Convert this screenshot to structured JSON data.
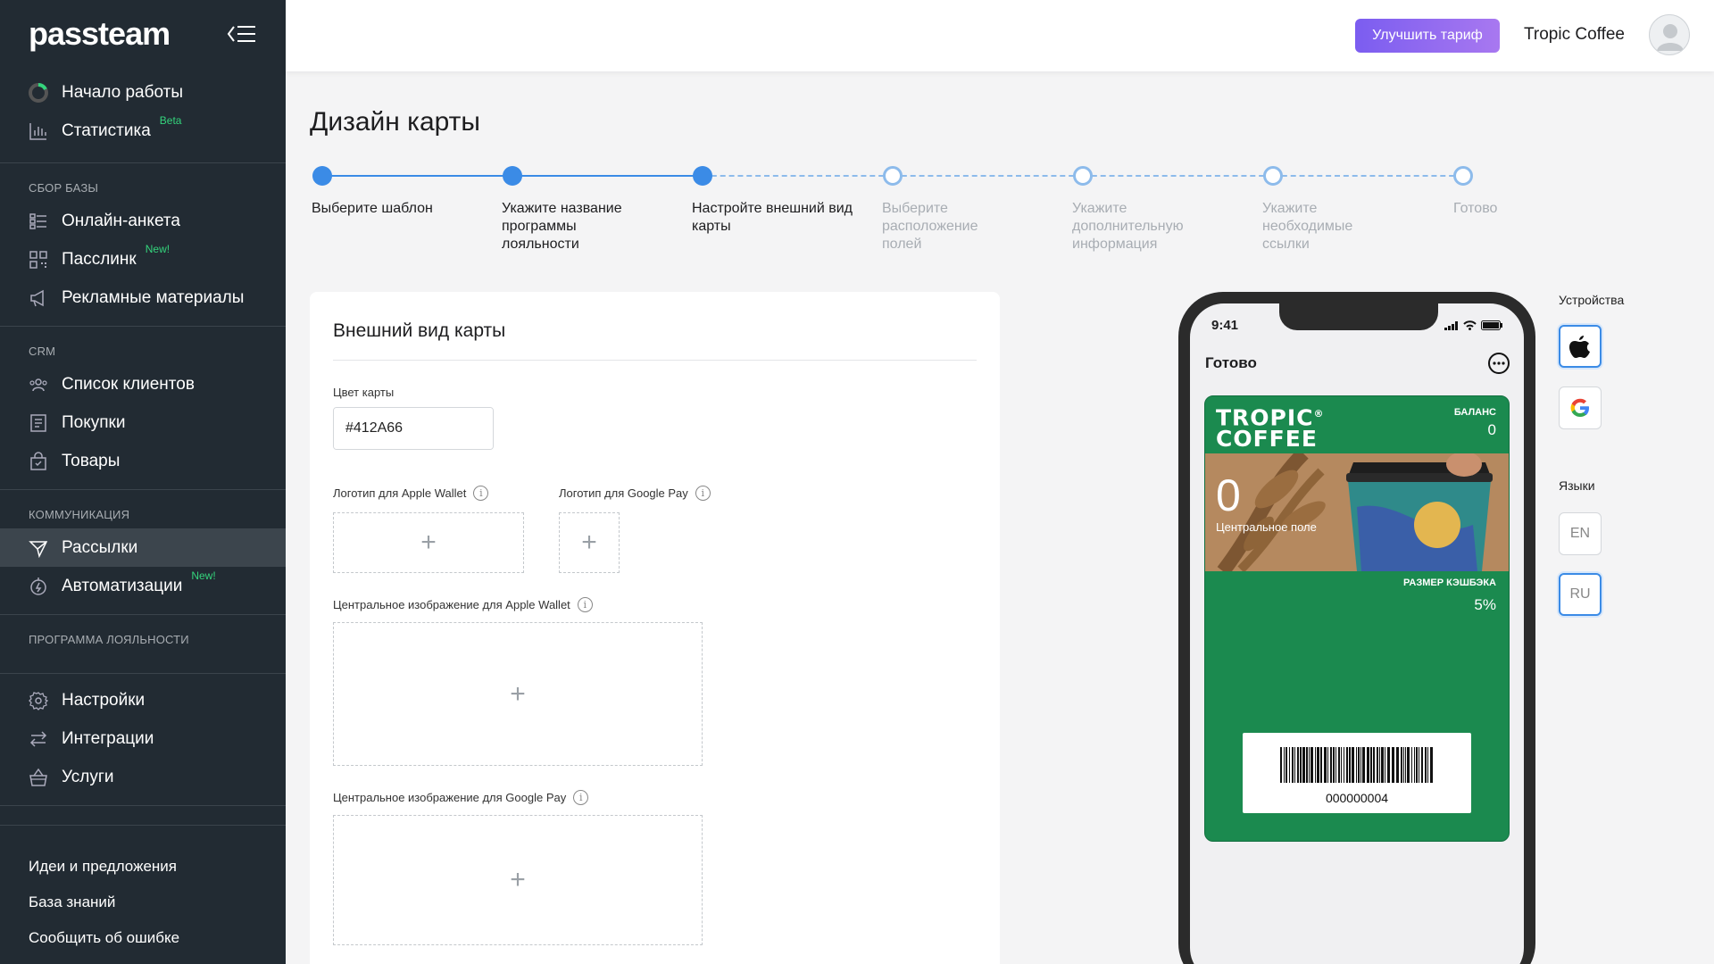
{
  "sidebar": {
    "logo": "passteam",
    "top_items": [
      {
        "label": "Начало работы",
        "icon": "progress-ring-icon"
      },
      {
        "label": "Статистика",
        "icon": "bar-chart-icon",
        "badge": "Beta"
      }
    ],
    "groups": [
      {
        "title": "СБОР БАЗЫ",
        "items": [
          {
            "label": "Онлайн-анкета",
            "icon": "form-icon"
          },
          {
            "label": "Пасслинк",
            "icon": "qr-icon",
            "badge": "New!"
          },
          {
            "label": "Рекламные материалы",
            "icon": "megaphone-icon"
          }
        ]
      },
      {
        "title": "CRM",
        "items": [
          {
            "label": "Список клиентов",
            "icon": "users-icon"
          },
          {
            "label": "Покупки",
            "icon": "receipt-icon"
          },
          {
            "label": "Товары",
            "icon": "bag-icon"
          }
        ]
      },
      {
        "title": "КОММУНИКАЦИЯ",
        "items": [
          {
            "label": "Рассылки",
            "icon": "send-icon",
            "active": true
          },
          {
            "label": "Автоматизации",
            "icon": "automation-icon",
            "badge": "New!"
          }
        ]
      },
      {
        "title": "ПРОГРАММА ЛОЯЛЬНОСТИ",
        "items": [
          {
            "label": "Настройки",
            "icon": "gear-icon"
          },
          {
            "label": "Интеграции",
            "icon": "swap-icon"
          },
          {
            "label": "Услуги",
            "icon": "basket-icon"
          }
        ]
      }
    ],
    "bottom_links": [
      "Идеи и предложения",
      "База знаний",
      "Сообщить об ошибке"
    ]
  },
  "topbar": {
    "upgrade_label": "Улучшить тариф",
    "company": "Tropic Coffee"
  },
  "page": {
    "title": "Дизайн карты"
  },
  "stepper": {
    "steps": [
      {
        "label": "Выберите шаблон",
        "done": true
      },
      {
        "label": "Укажите название программы лояльности",
        "done": true
      },
      {
        "label": "Настройте внешний вид карты",
        "done": true
      },
      {
        "label": "Выберите расположение полей",
        "done": false
      },
      {
        "label": "Укажите дополнительную информация",
        "done": false
      },
      {
        "label": "Укажите необходимые ссылки",
        "done": false
      },
      {
        "label": "Готово",
        "done": false
      }
    ]
  },
  "panel": {
    "title": "Внешний вид карты",
    "color_label": "Цвет карты",
    "color_value": "#412A66",
    "swatch_color": "#1b8a4f",
    "logo_apple_label": "Логотип для Apple Wallet",
    "logo_google_label": "Логотип для Google Pay",
    "center_apple_label": "Центральное изображение для Apple Wallet",
    "center_google_label": "Центральное изображение для Google Pay",
    "plus": "+",
    "info": "i"
  },
  "preview": {
    "time": "9:41",
    "done_label": "Готово",
    "brand_line1": "TROPIC",
    "brand_line2": "COFFEE",
    "brand_reg": "®",
    "balance_label": "БАЛАНС",
    "balance_value": "0",
    "center_value": "0",
    "center_label": "Центральное поле",
    "cashback_label": "РАЗМЕР КЭШБЭКА",
    "cashback_value": "5%",
    "barcode_number": "000000004",
    "card_color": "#1b8a4f"
  },
  "side": {
    "devices_title": "Устройства",
    "devices": [
      "apple-icon",
      "google-icon"
    ],
    "languages_title": "Языки",
    "languages": [
      "EN",
      "RU"
    ],
    "selected_language": "RU"
  }
}
